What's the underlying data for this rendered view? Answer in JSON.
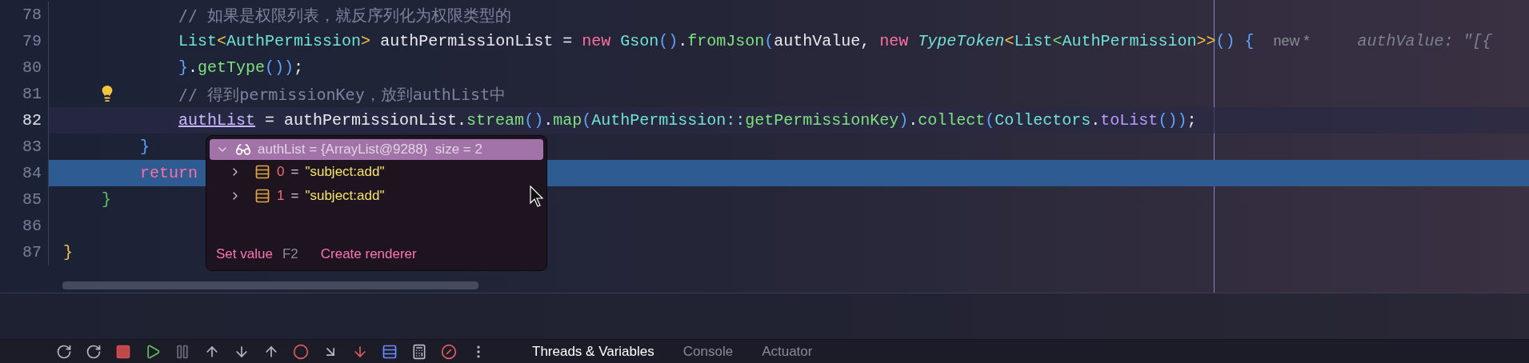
{
  "editor": {
    "lines": [
      {
        "number": "78",
        "current": false,
        "highlighted": false,
        "bulb": false,
        "tokens": [
          {
            "text": "            // 如果是权限列表，就反序列化为权限类型的",
            "kind": "comment"
          }
        ]
      },
      {
        "number": "79",
        "current": false,
        "highlighted": false,
        "bulb": false,
        "tokens": [
          {
            "text": "            List",
            "kind": "type"
          },
          {
            "text": "<",
            "kind": "angle"
          },
          {
            "text": "AuthPermission",
            "kind": "type"
          },
          {
            "text": ">",
            "kind": "angle"
          },
          {
            "text": " authPermissionList = ",
            "kind": "plain"
          },
          {
            "text": "new",
            "kind": "keyword"
          },
          {
            "text": " Gson",
            "kind": "type"
          },
          {
            "text": "()",
            "kind": "paren"
          },
          {
            "text": ".",
            "kind": "plain"
          },
          {
            "text": "fromJson",
            "kind": "method"
          },
          {
            "text": "(",
            "kind": "paren"
          },
          {
            "text": "authValue, ",
            "kind": "plain"
          },
          {
            "text": "new",
            "kind": "keyword"
          },
          {
            "text": " TypeToken",
            "kind": "italic-type"
          },
          {
            "text": "<",
            "kind": "angle"
          },
          {
            "text": "List",
            "kind": "type"
          },
          {
            "text": "<",
            "kind": "angle-green"
          },
          {
            "text": "AuthPermission",
            "kind": "type"
          },
          {
            "text": ">>",
            "kind": "angle"
          },
          {
            "text": "() {",
            "kind": "paren"
          },
          {
            "text": "new *",
            "kind": "hint"
          },
          {
            "text": "authValue: \"[{",
            "kind": "value-hint"
          }
        ]
      },
      {
        "number": "80",
        "current": false,
        "highlighted": false,
        "bulb": false,
        "tokens": [
          {
            "text": "            }",
            "kind": "paren"
          },
          {
            "text": ".",
            "kind": "plain"
          },
          {
            "text": "getType",
            "kind": "method"
          },
          {
            "text": "())",
            "kind": "paren"
          },
          {
            "text": ";",
            "kind": "plain"
          }
        ]
      },
      {
        "number": "81",
        "current": false,
        "highlighted": false,
        "bulb": true,
        "tokens": [
          {
            "text": "            // 得到permissionKey，放到authList中",
            "kind": "comment"
          }
        ]
      },
      {
        "number": "82",
        "current": true,
        "highlighted": false,
        "bulb": false,
        "tokens": [
          {
            "text": "            authList",
            "kind": "field"
          },
          {
            "text": " = authPermissionList.",
            "kind": "plain"
          },
          {
            "text": "stream",
            "kind": "method"
          },
          {
            "text": "()",
            "kind": "paren"
          },
          {
            "text": ".",
            "kind": "plain"
          },
          {
            "text": "map",
            "kind": "method"
          },
          {
            "text": "(",
            "kind": "paren"
          },
          {
            "text": "AuthPermission::",
            "kind": "type"
          },
          {
            "text": "getPermissionKey",
            "kind": "method"
          },
          {
            "text": ")",
            "kind": "paren"
          },
          {
            "text": ".",
            "kind": "plain"
          },
          {
            "text": "collect",
            "kind": "method"
          },
          {
            "text": "(",
            "kind": "paren"
          },
          {
            "text": "Collectors",
            "kind": "type"
          },
          {
            "text": ".",
            "kind": "plain"
          },
          {
            "text": "toList",
            "kind": "static"
          },
          {
            "text": "())",
            "kind": "paren"
          },
          {
            "text": ";",
            "kind": "plain"
          }
        ]
      },
      {
        "number": "83",
        "current": false,
        "highlighted": false,
        "bulb": false,
        "tokens": [
          {
            "text": "        }",
            "kind": "paren"
          }
        ]
      },
      {
        "number": "84",
        "current": false,
        "highlighted": true,
        "bulb": false,
        "tokens": [
          {
            "text": "        return",
            "kind": "keyword"
          }
        ]
      },
      {
        "number": "85",
        "current": false,
        "highlighted": false,
        "bulb": false,
        "tokens": [
          {
            "text": "    }",
            "kind": "brace-green"
          }
        ]
      },
      {
        "number": "86",
        "current": false,
        "highlighted": false,
        "bulb": false
      },
      {
        "number": "87",
        "current": false,
        "highlighted": false,
        "bulb": false,
        "tokens": [
          {
            "text": "}",
            "kind": "brace-yellow"
          }
        ]
      }
    ]
  },
  "popup": {
    "header": {
      "expanded": true,
      "text": "authList = {ArrayList@9288}  size = 2"
    },
    "items": [
      {
        "expanded": false,
        "index": "0",
        "operator": "=",
        "value": "\"subject:add\""
      },
      {
        "expanded": false,
        "index": "1",
        "operator": "=",
        "value": "\"subject:add\""
      }
    ],
    "actions": [
      {
        "label": "Set value",
        "shortcut": "F2"
      },
      {
        "label": "Create renderer"
      }
    ]
  },
  "debug_tabs": [
    {
      "label": "Threads & Variables",
      "selected": true
    },
    {
      "label": "Console",
      "selected": false
    },
    {
      "label": "Actuator",
      "selected": false
    }
  ]
}
